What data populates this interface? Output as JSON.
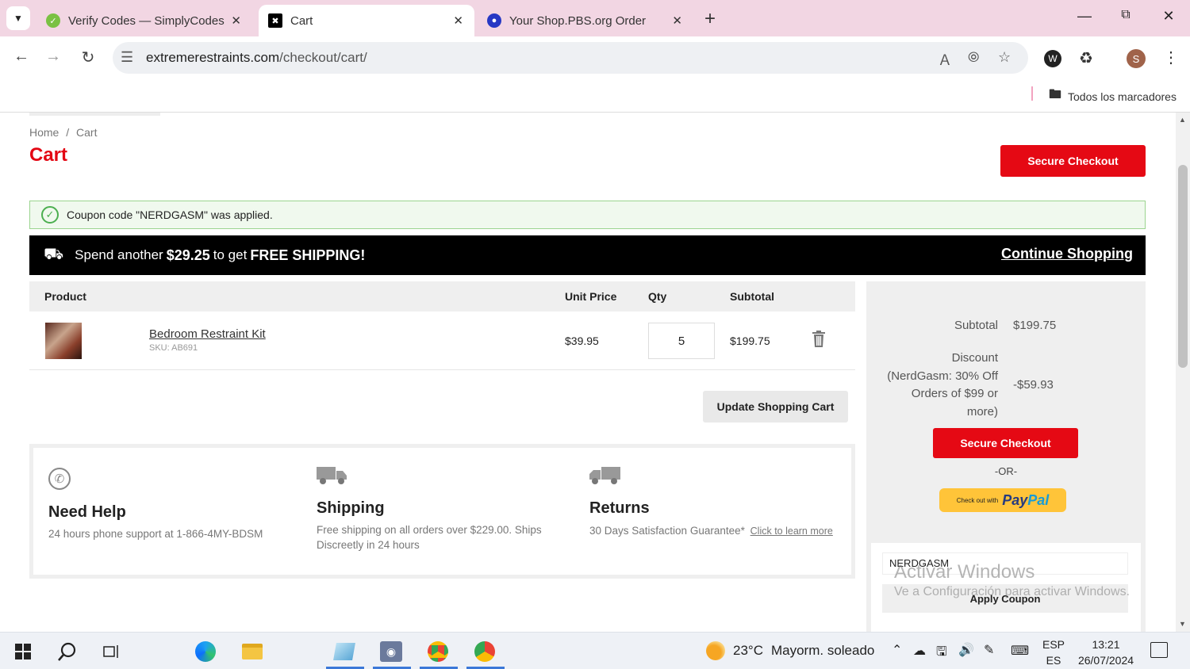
{
  "browser": {
    "tabs": [
      {
        "label": "Verify Codes — SimplyCodes",
        "active": false
      },
      {
        "label": "Cart",
        "active": true
      },
      {
        "label": "Your Shop.PBS.org Order",
        "active": false
      }
    ],
    "url_domain": "extremerestraints.com",
    "url_path": "/checkout/cart/",
    "bookmarks_label": "Todos los marcadores",
    "profile_initial": "S"
  },
  "page": {
    "breadcrumb": {
      "home": "Home",
      "separator": "/",
      "current": "Cart"
    },
    "title": "Cart",
    "secure_checkout_label": "Secure Checkout",
    "coupon_notice": "Coupon code \"NERDGASM\" was applied.",
    "shipping_banner": {
      "prefix": "Spend another",
      "amount": "$29.25",
      "middle": "to get",
      "highlight": "FREE SHIPPING!",
      "continue_label": "Continue Shopping"
    },
    "table": {
      "headers": {
        "product": "Product",
        "unit_price": "Unit Price",
        "qty": "Qty",
        "subtotal": "Subtotal"
      },
      "items": [
        {
          "name": "Bedroom Restraint Kit",
          "sku": "SKU: AB691",
          "unit_price": "$39.95",
          "qty": "5",
          "subtotal": "$199.75"
        }
      ],
      "update_label": "Update Shopping Cart"
    },
    "summary": {
      "subtotal_label": "Subtotal",
      "subtotal_value": "$199.75",
      "discount_label_lines": [
        "Discount",
        "(NerdGasm: 30% Off",
        "Orders of $99 or",
        "more)"
      ],
      "discount_value": "-$59.93",
      "checkout_label": "Secure Checkout",
      "or_label": "-OR-",
      "paypal_prefix": "Check out with",
      "paypal_brand_a": "Pay",
      "paypal_brand_b": "Pal",
      "coupon_value": "NERDGASM",
      "apply_label": "Apply Coupon"
    },
    "info": {
      "help_title": "Need Help",
      "help_text": "24 hours phone support at 1-866-4MY-BDSM",
      "shipping_title": "Shipping",
      "shipping_text_lines": [
        "Free shipping on all orders over $229.00. Ships",
        "Discreetly in 24 hours"
      ],
      "returns_title": "Returns",
      "returns_text": "30 Days Satisfaction Guarantee*",
      "returns_link": "Click to learn more"
    },
    "watermark": {
      "title": "Activar Windows",
      "subtitle": "Ve a Configuración para activar Windows."
    }
  },
  "taskbar": {
    "weather_temp": "23°C",
    "weather_text": "Mayorm. soleado",
    "lang_top": "ESP",
    "lang_bottom": "ES",
    "time": "13:21",
    "date": "26/07/2024"
  },
  "colors": {
    "accent_red": "#e50914",
    "title_red": "#e30613",
    "success_green": "#4caf50",
    "banner_black": "#000000",
    "paypal_yellow": "#ffc439",
    "tab_bar_pink": "#f2d6e3"
  }
}
